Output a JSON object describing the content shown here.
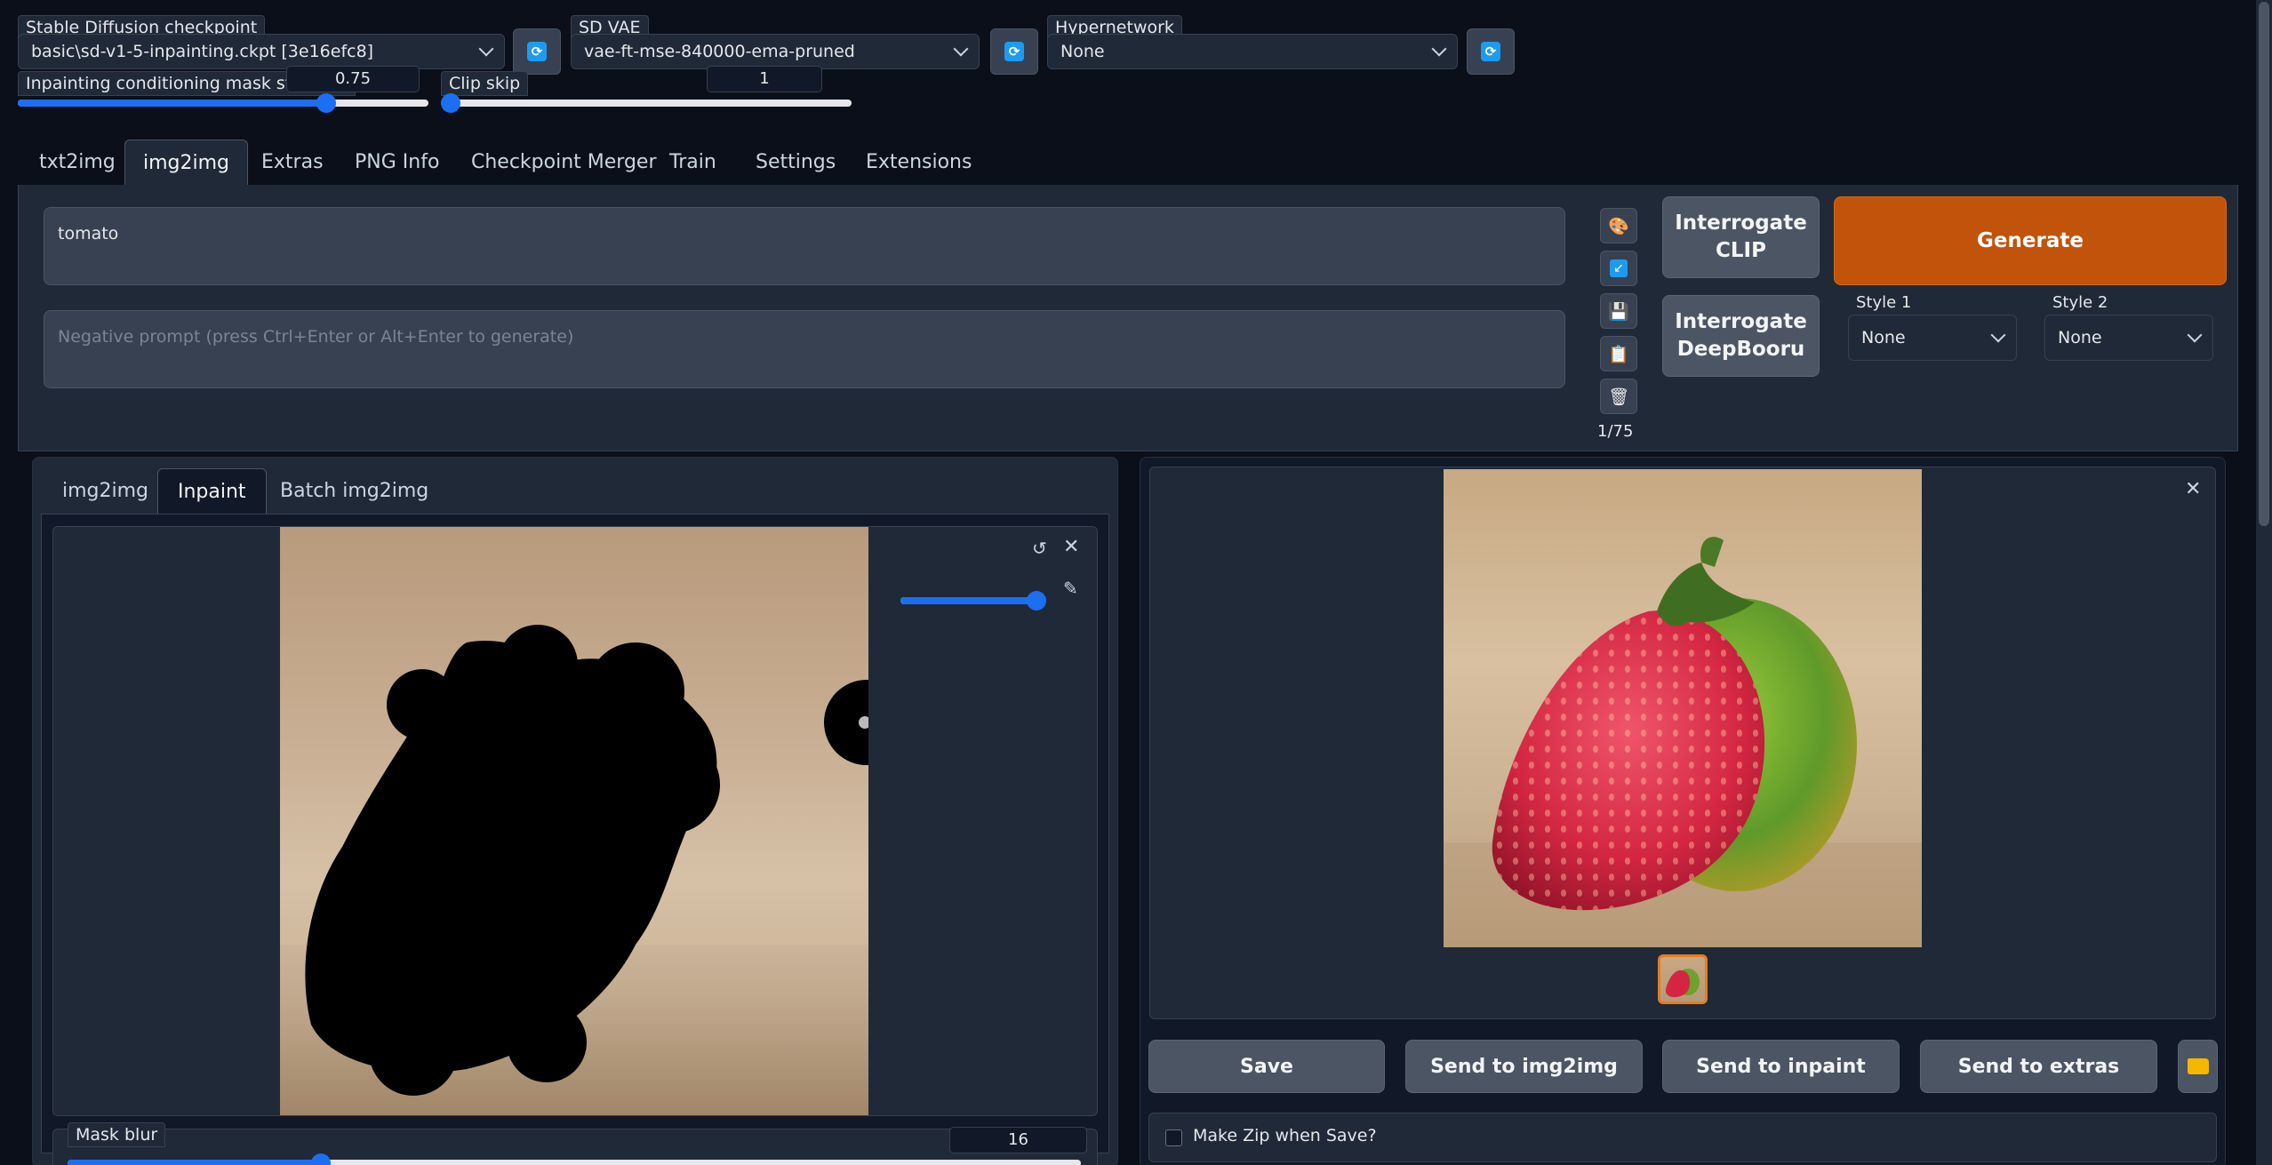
{
  "settings": {
    "checkpoint": {
      "label": "Stable Diffusion checkpoint",
      "value": "basic\\sd-v1-5-inpainting.ckpt [3e16efc8]"
    },
    "vae": {
      "label": "SD VAE",
      "value": "vae-ft-mse-840000-ema-pruned"
    },
    "hypernetwork": {
      "label": "Hypernetwork",
      "value": "None"
    },
    "mask_strength": {
      "label": "Inpainting conditioning mask strength",
      "value": "0.75",
      "fraction": 0.75
    },
    "clip_skip": {
      "label": "Clip skip",
      "value": "1",
      "fraction": 0.0
    }
  },
  "tabs": [
    "txt2img",
    "img2img",
    "Extras",
    "PNG Info",
    "Checkpoint Merger",
    "Train",
    "Settings",
    "Extensions"
  ],
  "active_tab": "img2img",
  "prompt": {
    "value": "tomato"
  },
  "negative_prompt": {
    "placeholder": "Negative prompt (press Ctrl+Enter or Alt+Enter to generate)"
  },
  "tool_icons": [
    "palette-icon",
    "arrow-icon",
    "save-icon",
    "clipboard-icon",
    "trash-icon"
  ],
  "token_count": "1/75",
  "buttons": {
    "interrogate_clip": "Interrogate CLIP",
    "interrogate_deepbooru": "Interrogate DeepBooru",
    "generate": "Generate"
  },
  "styles": {
    "style1": {
      "label": "Style 1",
      "value": "None"
    },
    "style2": {
      "label": "Style 2",
      "value": "None"
    }
  },
  "subtabs": [
    "img2img",
    "Inpaint",
    "Batch img2img"
  ],
  "active_subtab": "Inpaint",
  "brush_size_fraction": 1.0,
  "mask_blur": {
    "label": "Mask blur",
    "value": "16",
    "fraction": 0.25
  },
  "output": {
    "actions": [
      "Save",
      "Send to img2img",
      "Send to inpaint",
      "Send to extras"
    ],
    "make_zip_label": "Make Zip when Save?"
  },
  "colors": {
    "accent": "#1d6ff2",
    "generate": "#c2530a",
    "background": "#0b0f19",
    "panel": "#1f2937"
  }
}
